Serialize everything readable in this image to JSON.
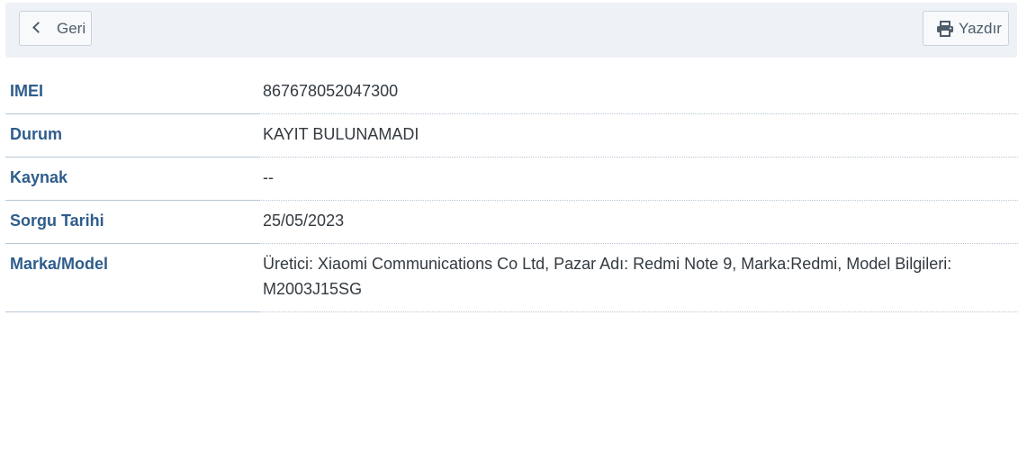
{
  "toolbar": {
    "back_label": "Geri",
    "print_label": "Yazdır"
  },
  "details": [
    {
      "label": "IMEI",
      "value": "867678052047300"
    },
    {
      "label": "Durum",
      "value": "KAYIT BULUNAMADI"
    },
    {
      "label": "Kaynak",
      "value": "--"
    },
    {
      "label": "Sorgu Tarihi",
      "value": "25/05/2023"
    },
    {
      "label": "Marka/Model",
      "value": "Üretici: Xiaomi Communications Co Ltd, Pazar Adı: Redmi Note 9, Marka:Redmi, Model Bilgileri: M2003J15SG"
    }
  ],
  "colors": {
    "label": "#2f5d8c",
    "value": "#333a40",
    "toolbar_bg": "#eef2f7"
  }
}
